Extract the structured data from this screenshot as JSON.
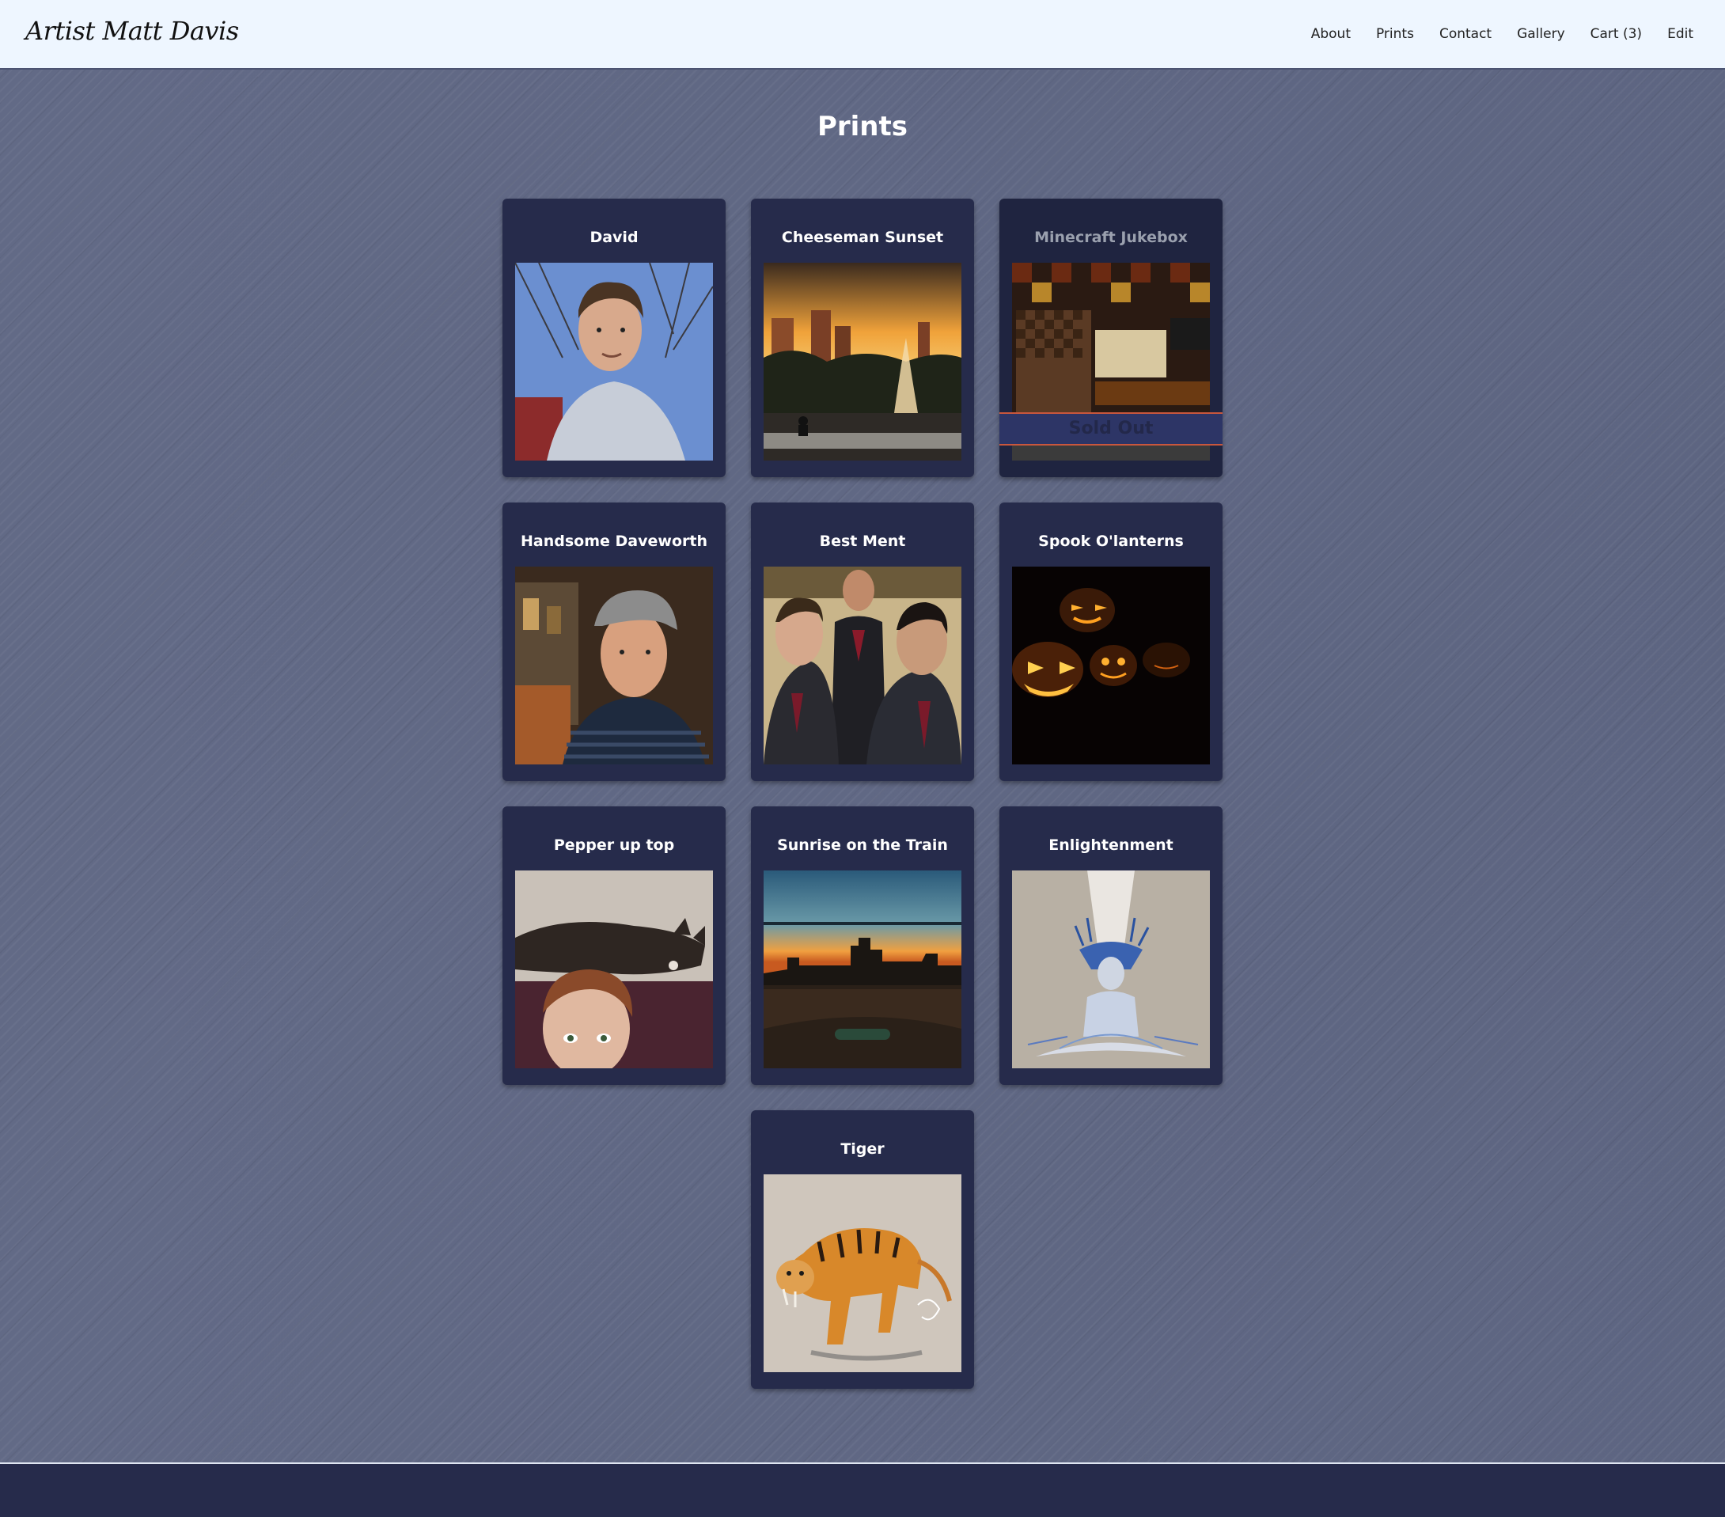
{
  "site": {
    "logo": "Artist Matt Davis"
  },
  "nav": {
    "items": [
      {
        "label": "About"
      },
      {
        "label": "Prints"
      },
      {
        "label": "Contact"
      },
      {
        "label": "Gallery"
      },
      {
        "label": "Cart (3)"
      },
      {
        "label": "Edit"
      }
    ]
  },
  "page": {
    "title": "Prints"
  },
  "prints": [
    {
      "title": "David"
    },
    {
      "title": "Cheeseman Sunset"
    },
    {
      "title": "Minecraft Jukebox",
      "status": "Sold Out"
    },
    {
      "title": "Handsome Daveworth"
    },
    {
      "title": "Best Ment"
    },
    {
      "title": "Spook O'lanterns"
    },
    {
      "title": "Pepper up top"
    },
    {
      "title": "Sunrise on the Train"
    },
    {
      "title": "Enlightenment"
    },
    {
      "title": "Tiger"
    }
  ],
  "colors": {
    "header_bg": "#eef6ff",
    "page_bg": "#5f6784",
    "card_bg": "#262b4b",
    "sold_band": "#2d3566",
    "sold_border": "#c9573d",
    "footer_bg": "#262b4b"
  }
}
